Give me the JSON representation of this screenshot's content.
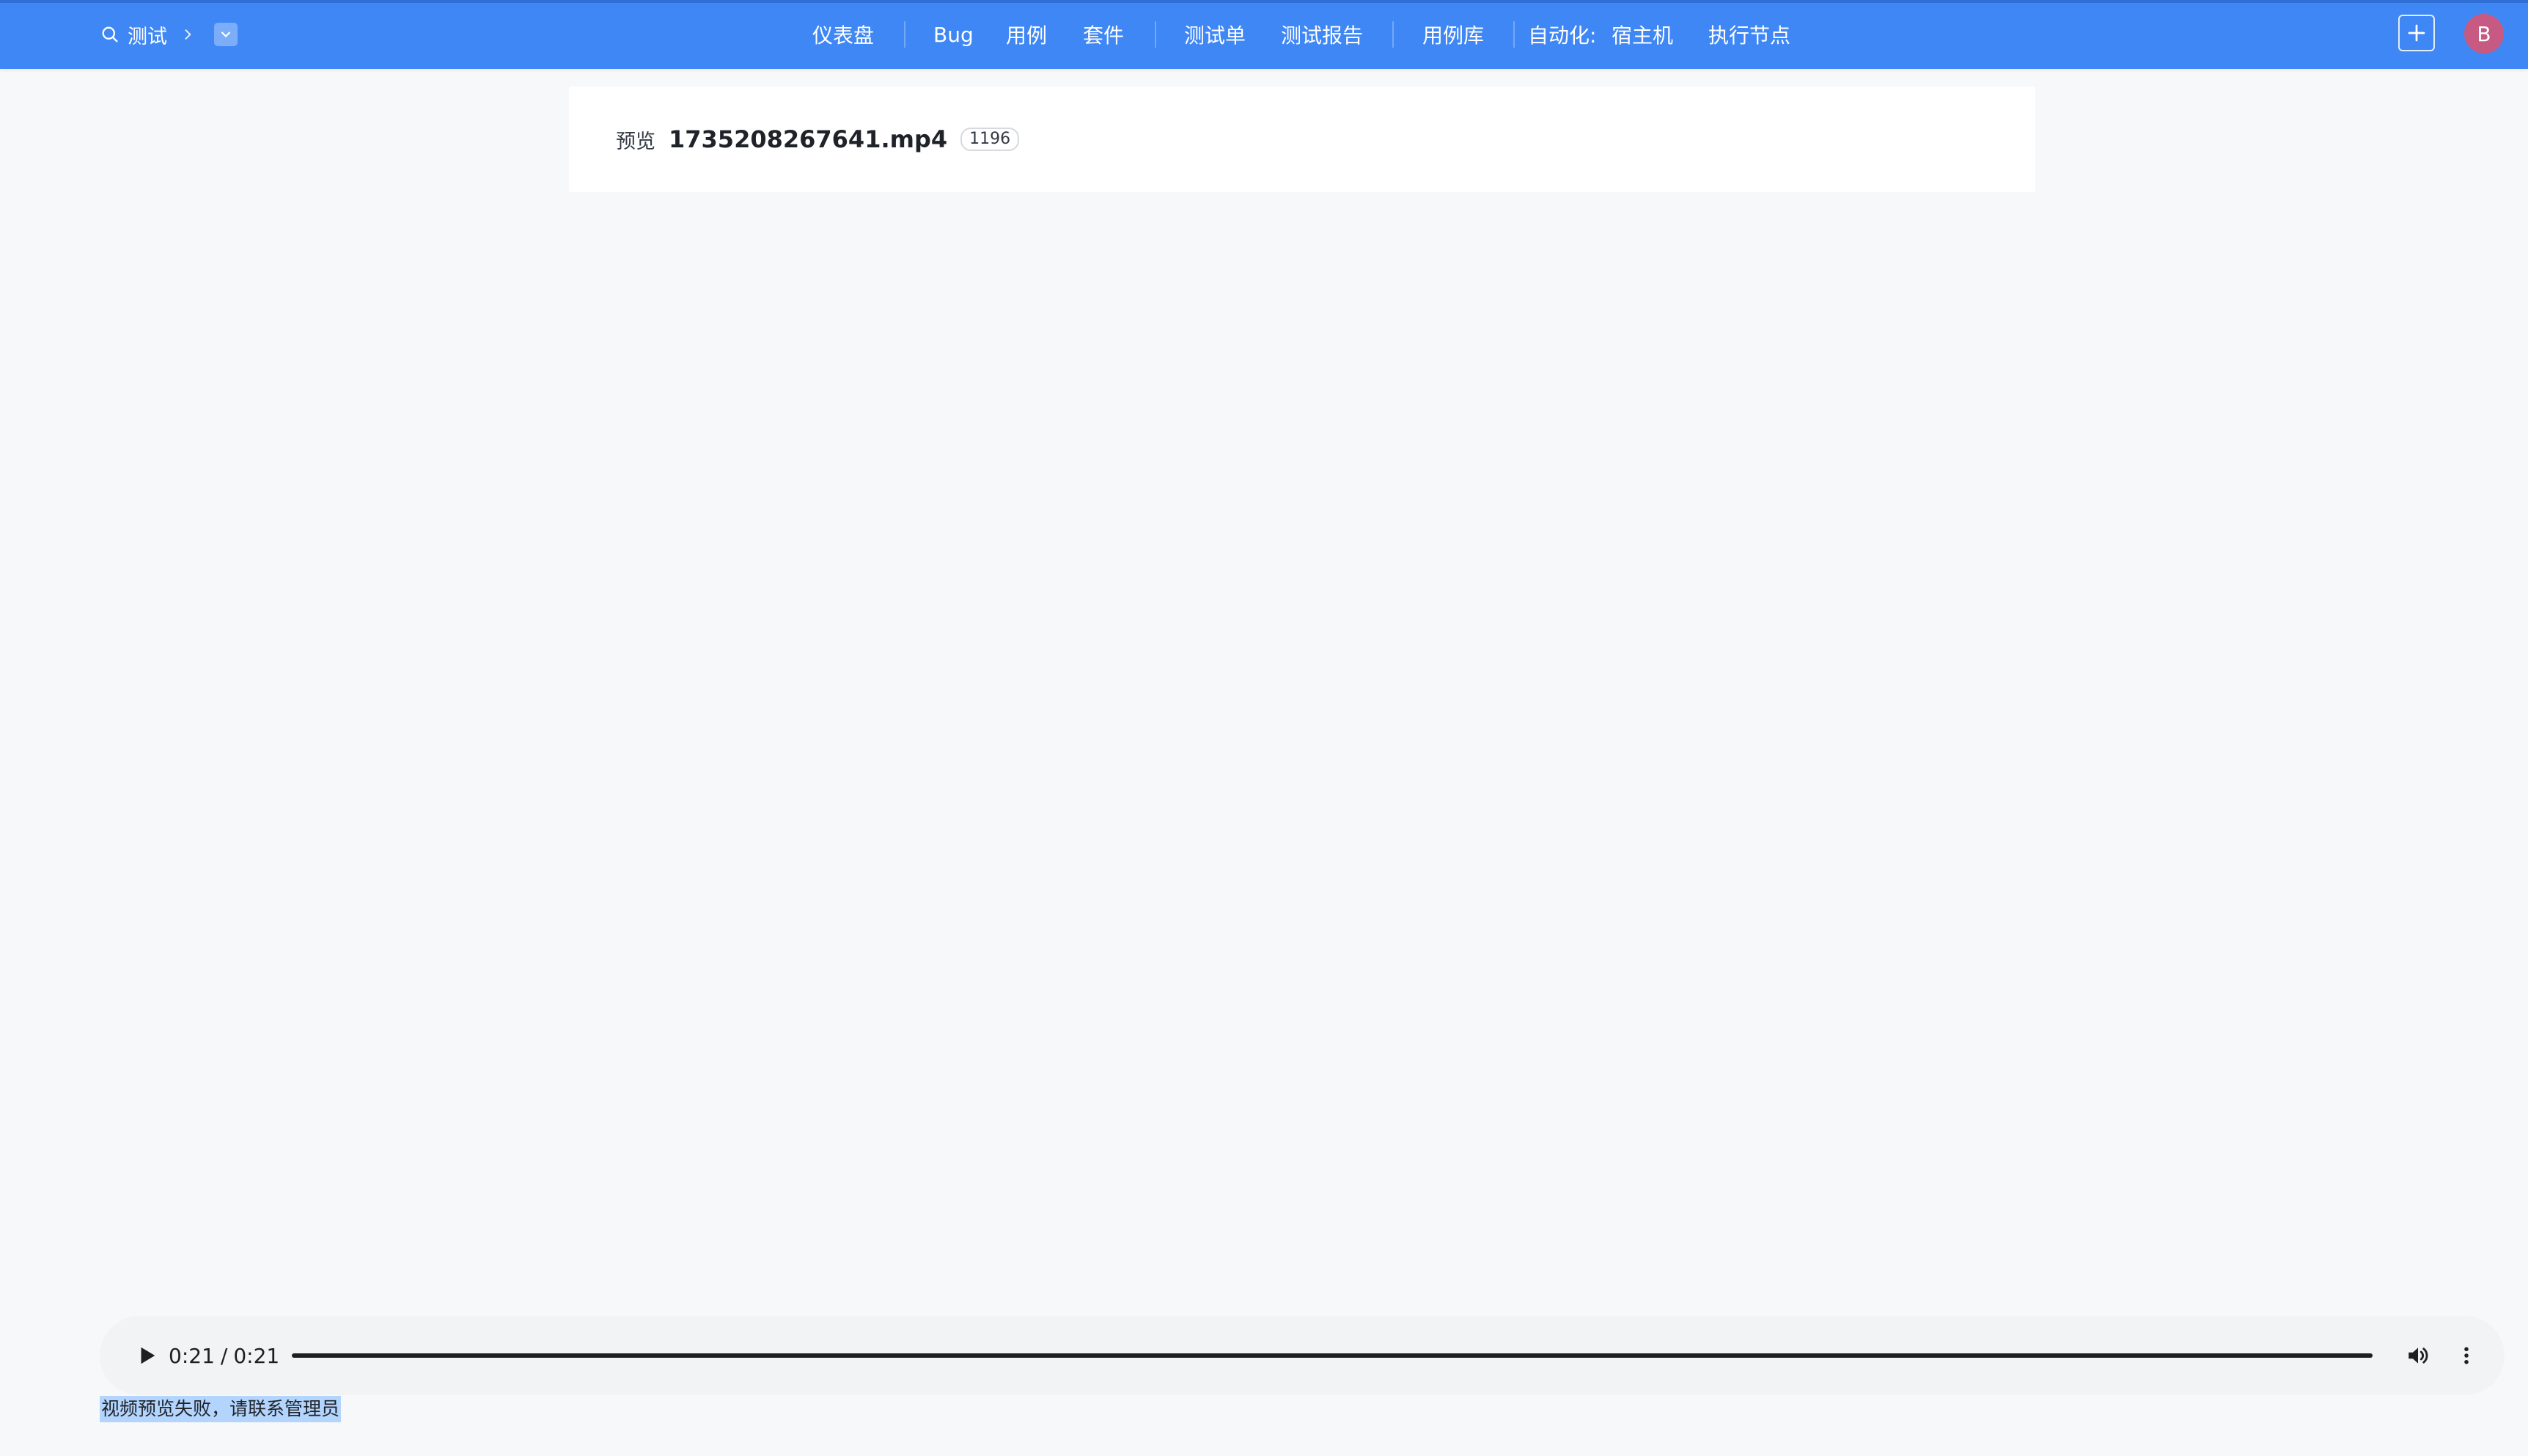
{
  "colors": {
    "topbar": "#3f87f5",
    "avatar": "#c75a82",
    "page_background": "#f7f8fa",
    "text_selection": "#b3d4fd"
  },
  "topbar": {
    "project_name": "测试",
    "search_icon": "search-icon",
    "nav": {
      "dashboard": "仪表盘",
      "bug": "Bug",
      "cases": "用例",
      "suites": "套件",
      "test_orders": "测试单",
      "test_reports": "测试报告",
      "case_library": "用例库",
      "automation_label": "自动化:",
      "hosts": "宿主机",
      "exec_nodes": "执行节点"
    },
    "add_icon": "plus-icon",
    "avatar_initial": "B"
  },
  "preview": {
    "label": "预览",
    "file_name": "1735208267641.mp4",
    "size_badge": "1196"
  },
  "player": {
    "current_time": "0:21",
    "separator": "/",
    "duration": "0:21",
    "progress": 1.0
  },
  "error_message": "视频预览失败，请联系管理员"
}
